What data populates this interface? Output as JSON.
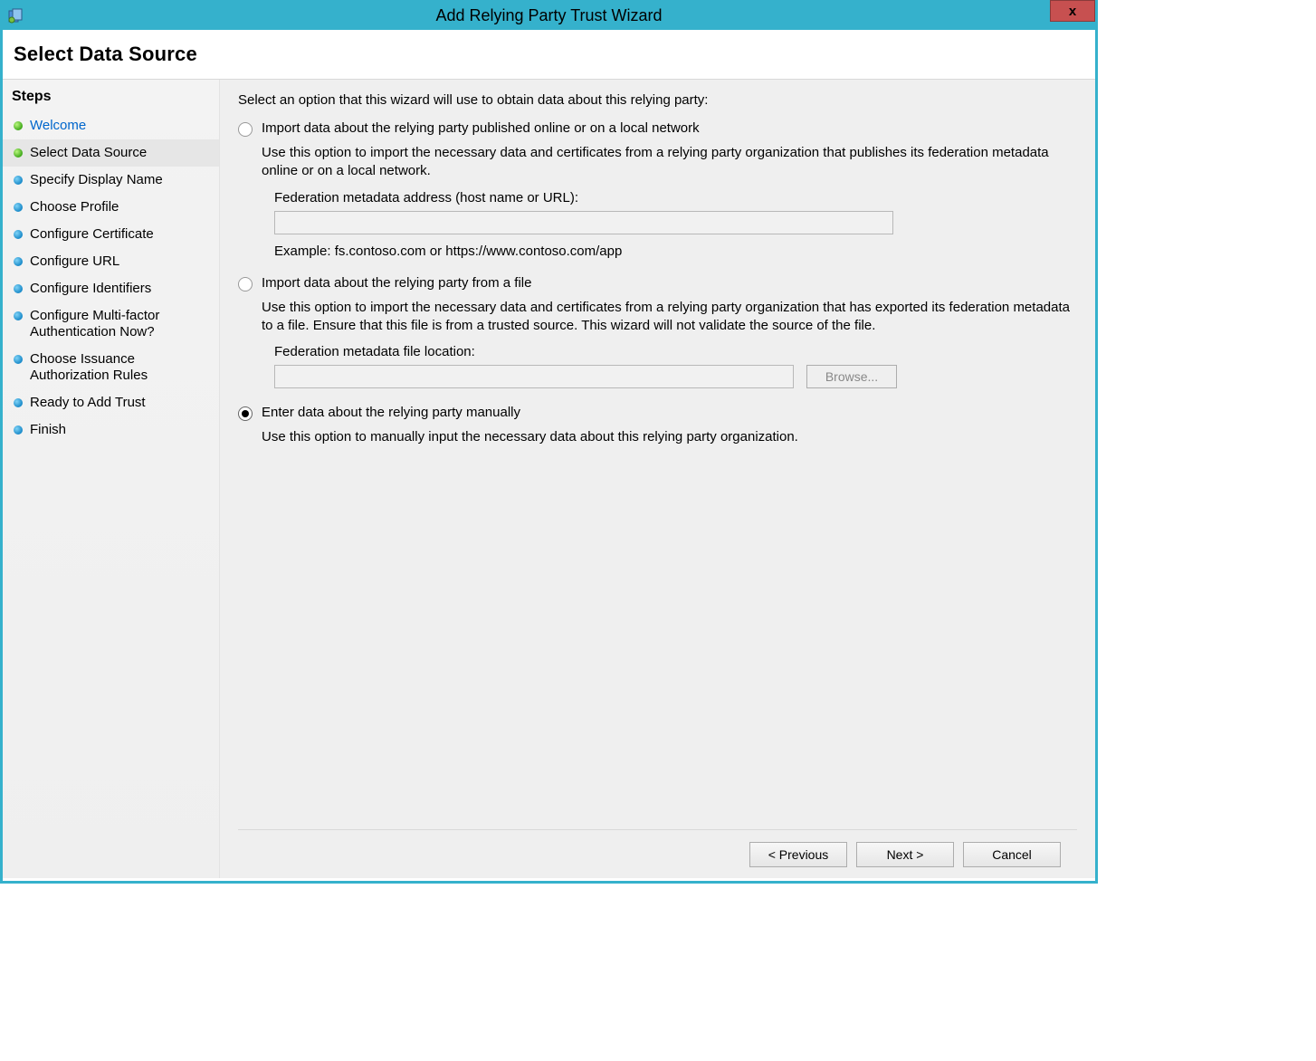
{
  "window": {
    "title": "Add Relying Party Trust Wizard",
    "heading": "Select Data Source"
  },
  "sidebar": {
    "header": "Steps",
    "items": [
      {
        "label": "Welcome",
        "bullet": "green",
        "link": true
      },
      {
        "label": "Select Data Source",
        "bullet": "green",
        "current": true
      },
      {
        "label": "Specify Display Name",
        "bullet": "blue"
      },
      {
        "label": "Choose Profile",
        "bullet": "blue"
      },
      {
        "label": "Configure Certificate",
        "bullet": "blue"
      },
      {
        "label": "Configure URL",
        "bullet": "blue"
      },
      {
        "label": "Configure Identifiers",
        "bullet": "blue"
      },
      {
        "label": "Configure Multi-factor Authentication Now?",
        "bullet": "blue"
      },
      {
        "label": "Choose Issuance Authorization Rules",
        "bullet": "blue"
      },
      {
        "label": "Ready to Add Trust",
        "bullet": "blue"
      },
      {
        "label": "Finish",
        "bullet": "blue"
      }
    ]
  },
  "main": {
    "instruction": "Select an option that this wizard will use to obtain data about this relying party:",
    "option1": {
      "title": "Import data about the relying party published online or on a local network",
      "desc": "Use this option to import the necessary data and certificates from a relying party organization that publishes its federation metadata online or on a local network.",
      "field_label": "Federation metadata address (host name or URL):",
      "field_value": "",
      "example": "Example: fs.contoso.com or https://www.contoso.com/app"
    },
    "option2": {
      "title": "Import data about the relying party from a file",
      "desc": "Use this option to import the necessary data and certificates from a relying party organization that has exported its federation metadata to a file. Ensure that this file is from a trusted source.  This wizard will not validate the source of the file.",
      "field_label": "Federation metadata file location:",
      "field_value": "",
      "browse": "Browse..."
    },
    "option3": {
      "title": "Enter data about the relying party manually",
      "desc": "Use this option to manually input the necessary data about this relying party organization."
    },
    "selected": "option3"
  },
  "footer": {
    "previous": "< Previous",
    "next": "Next >",
    "cancel": "Cancel"
  }
}
